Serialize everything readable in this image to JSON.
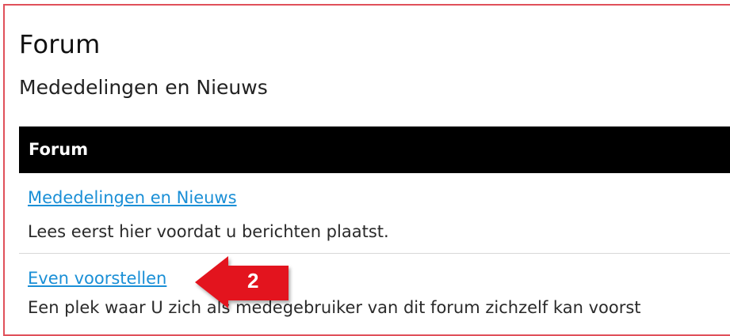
{
  "page": {
    "title": "Forum",
    "subtitle": "Mededelingen en Nieuws"
  },
  "table": {
    "header": "Forum",
    "rows": [
      {
        "link": "Mededelingen en Nieuws",
        "description": "Lees eerst hier voordat u berichten plaatst."
      },
      {
        "link": "Even voorstellen",
        "description": "Een plek waar U zich als medegebruiker van dit forum zichzelf kan voorst"
      }
    ]
  },
  "callout": {
    "label": "2",
    "icon": "left-arrow-icon",
    "color": "#e3141e"
  },
  "colors": {
    "frame_border": "#e0505a",
    "link": "#1a8fd6",
    "header_bg": "#000000"
  }
}
